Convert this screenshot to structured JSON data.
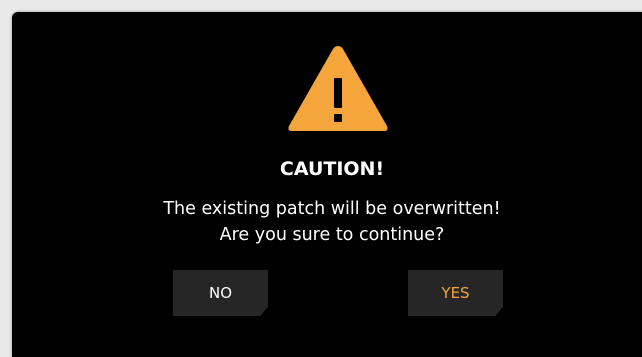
{
  "dialog": {
    "icon": "warning-triangle-icon",
    "title": "CAUTION!",
    "message_line1": "The existing patch will be overwritten!",
    "message_line2": "Are you sure to continue?",
    "buttons": {
      "no_label": "NO",
      "yes_label": "YES"
    }
  },
  "colors": {
    "background": "#000000",
    "warning_accent": "#f4a63d",
    "button_bg": "#262626",
    "text": "#ffffff"
  }
}
